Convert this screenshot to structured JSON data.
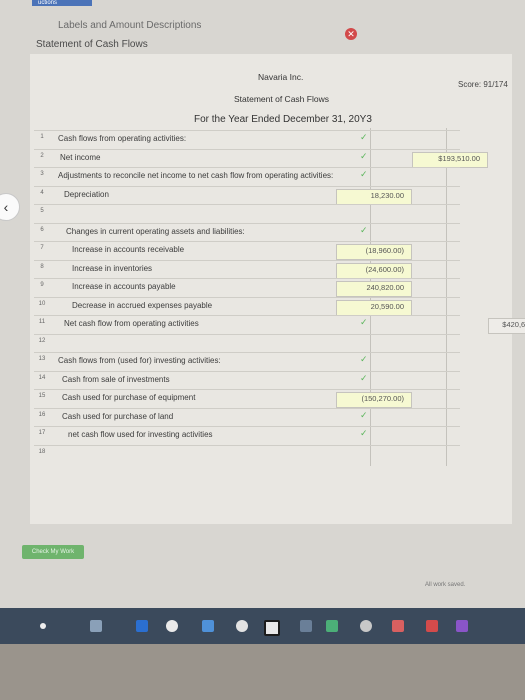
{
  "header": {
    "top_strip": "uctions",
    "subtitle": "Labels and Amount Descriptions",
    "title": "Statement of Cash Flows",
    "close_icon": "close-icon"
  },
  "score": "Score: 91/174",
  "statement": {
    "company": "Navaria Inc.",
    "name": "Statement of Cash Flows",
    "period": "For the Year Ended December 31, 20Y3"
  },
  "rows": [
    {
      "num": "1",
      "label": "Cash flows from operating activities:"
    },
    {
      "num": "2",
      "label": "Net income",
      "col2": "$193,510.00"
    },
    {
      "num": "3",
      "label": "Adjustments to reconcile net income to net cash flow from operating activities:"
    },
    {
      "num": "4",
      "label": "Depreciation",
      "col1": "18,230.00"
    },
    {
      "num": "5",
      "label": ""
    },
    {
      "num": "6",
      "label": "Changes in current operating assets and liabilities:"
    },
    {
      "num": "7",
      "label": "Increase in accounts receivable",
      "col1": "(18,960.00)"
    },
    {
      "num": "8",
      "label": "Increase in inventories",
      "col1": "(24,600.00)"
    },
    {
      "num": "9",
      "label": "Increase in accounts payable",
      "col1": "240,820.00"
    },
    {
      "num": "10",
      "label": "Decrease in accrued expenses payable",
      "col1": "20,590.00"
    },
    {
      "num": "11",
      "label": "Net cash flow from operating activities",
      "col3": "$420,620.00"
    },
    {
      "num": "12",
      "label": ""
    },
    {
      "num": "13",
      "label": "Cash flows from (used for) investing activities:"
    },
    {
      "num": "14",
      "label": "Cash from sale of investments"
    },
    {
      "num": "15",
      "label": "Cash used for purchase of equipment",
      "col1": "(150,270.00)"
    },
    {
      "num": "16",
      "label": "Cash used for purchase of land"
    },
    {
      "num": "17",
      "label": "net cash flow used for investing activities"
    },
    {
      "num": "18",
      "label": ""
    }
  ],
  "check_button": "Check My Work",
  "status": "All work saved.",
  "colors": {
    "accent_green": "#6fb46d",
    "close_red": "#d24a4a",
    "highlight": "#f6f9d2"
  }
}
